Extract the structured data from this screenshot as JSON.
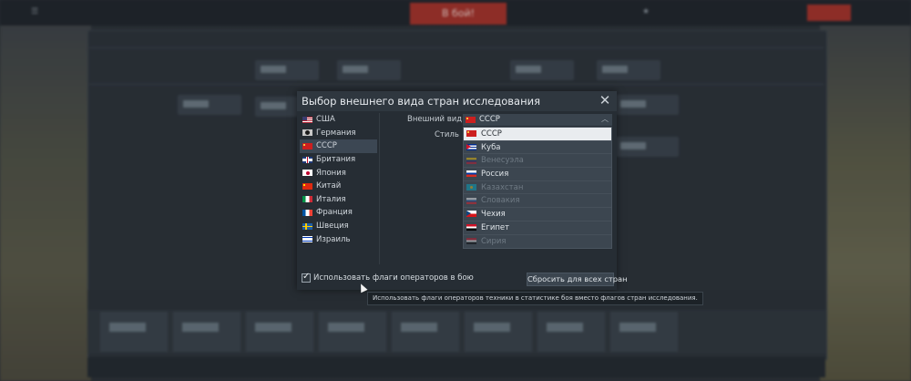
{
  "dialog": {
    "title": "Выбор внешнего вида стран исследования",
    "close_icon": "close-icon",
    "appearance_label": "Внешний вид",
    "style_label": "Стиль",
    "selected_appearance": {
      "label": "СССР",
      "flag": "ussr-flag-icon"
    },
    "countries": [
      {
        "label": "США",
        "flag": "usa-flag-icon",
        "selected": false
      },
      {
        "label": "Германия",
        "flag": "germany-flag-icon",
        "selected": false
      },
      {
        "label": "СССР",
        "flag": "ussr-flag-icon",
        "selected": true
      },
      {
        "label": "Британия",
        "flag": "uk-flag-icon",
        "selected": false
      },
      {
        "label": "Япония",
        "flag": "japan-flag-icon",
        "selected": false
      },
      {
        "label": "Китай",
        "flag": "china-flag-icon",
        "selected": false
      },
      {
        "label": "Италия",
        "flag": "italy-flag-icon",
        "selected": false
      },
      {
        "label": "Франция",
        "flag": "france-flag-icon",
        "selected": false
      },
      {
        "label": "Швеция",
        "flag": "sweden-flag-icon",
        "selected": false
      },
      {
        "label": "Израиль",
        "flag": "israel-flag-icon",
        "selected": false
      }
    ],
    "options": [
      {
        "label": "СССР",
        "flag": "ussr-flag-icon",
        "highlighted": true,
        "disabled": false
      },
      {
        "label": "Куба",
        "flag": "cuba-flag-icon",
        "highlighted": false,
        "disabled": false
      },
      {
        "label": "Венесуэла",
        "flag": "venezuela-flag-icon",
        "highlighted": false,
        "disabled": true
      },
      {
        "label": "Россия",
        "flag": "russia-flag-icon",
        "highlighted": false,
        "disabled": false
      },
      {
        "label": "Казахстан",
        "flag": "kazakhstan-flag-icon",
        "highlighted": false,
        "disabled": true
      },
      {
        "label": "Словакия",
        "flag": "slovakia-flag-icon",
        "highlighted": false,
        "disabled": true
      },
      {
        "label": "Чехия",
        "flag": "czechia-flag-icon",
        "highlighted": false,
        "disabled": false
      },
      {
        "label": "Египет",
        "flag": "egypt-flag-icon",
        "highlighted": false,
        "disabled": false
      },
      {
        "label": "Сирия",
        "flag": "syria-flag-icon",
        "highlighted": false,
        "disabled": true
      }
    ],
    "use_operator_flags_label": "Использовать флаги операторов в бою",
    "use_operator_flags_checked": true,
    "reset_button": "Сбросить для всех стран",
    "tooltip": "Использовать флаги операторов техники в статистике боя вместо флагов стран исследования."
  },
  "background": {
    "battle_button": "В бой!"
  },
  "colors": {
    "dialog_bg": "#262d34",
    "selected_row": "#3c4753",
    "highlight_option": "#e9ecef",
    "battle_red": "#a8322a"
  }
}
